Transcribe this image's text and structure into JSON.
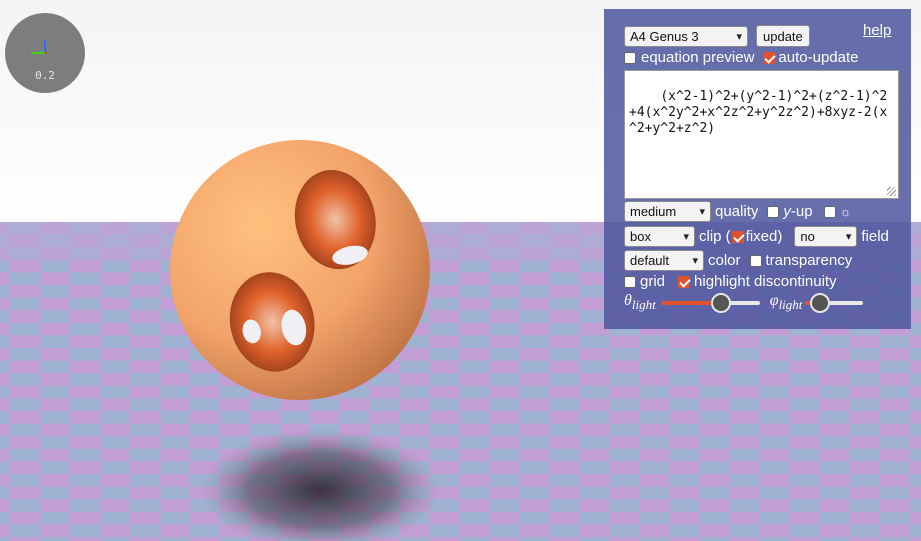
{
  "viewport": {
    "axis_scale": "0.2"
  },
  "panel": {
    "preset_select": "A4 Genus 3",
    "update_button": "update",
    "help_link": "help",
    "equation_preview": {
      "label": "equation preview",
      "checked": false
    },
    "auto_update": {
      "label": "auto-update",
      "checked": true
    },
    "equation": "(x^2-1)^2+(y^2-1)^2+(z^2-1)^2+4(x^2y^2+x^2z^2+y^2z^2)+8xyz-2(x^2+y^2+z^2)",
    "quality": {
      "value": "medium",
      "label": "quality"
    },
    "y_up": {
      "label_em": "y",
      "label_rest": "-up",
      "checked": false
    },
    "sun": {
      "glyph": "☼",
      "checked": false
    },
    "clip": {
      "value": "box",
      "label_before": "clip (",
      "fixed_label": "fixed)",
      "fixed_checked": true
    },
    "field": {
      "value": "no",
      "label": "field"
    },
    "color": {
      "value": "default",
      "label": "color"
    },
    "transparency": {
      "label": "transparency",
      "checked": false
    },
    "grid": {
      "label": "grid",
      "checked": false
    },
    "highlight": {
      "label": "highlight discontinuity",
      "checked": true
    },
    "theta_light": {
      "symbol": "θ",
      "sub": "light",
      "value": 0.6
    },
    "phi_light": {
      "symbol": "φ",
      "sub": "light",
      "value": 0.25
    }
  }
}
